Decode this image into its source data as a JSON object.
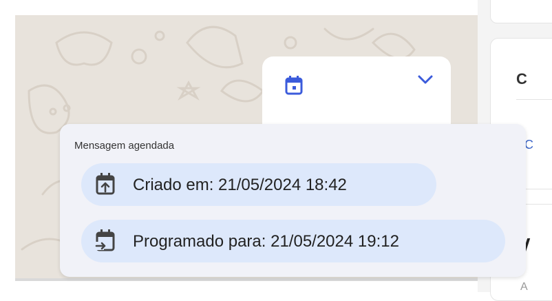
{
  "header": {
    "calendar_icon": "calendar-icon",
    "expand_icon": "chevron-down-icon",
    "accent_color": "#3b5bdb"
  },
  "popup": {
    "title": "Mensagem agendada",
    "created": {
      "label": "Criado em: 21/05/2024 18:42",
      "icon": "calendar-upload-icon"
    },
    "scheduled": {
      "label": "Programado para: 21/05/2024 19:12",
      "icon": "calendar-arrow-right-icon"
    },
    "chip_color": "#dde8fb"
  },
  "side_panel": {
    "heading": "C",
    "link_text": "C",
    "partial_text": "A"
  }
}
